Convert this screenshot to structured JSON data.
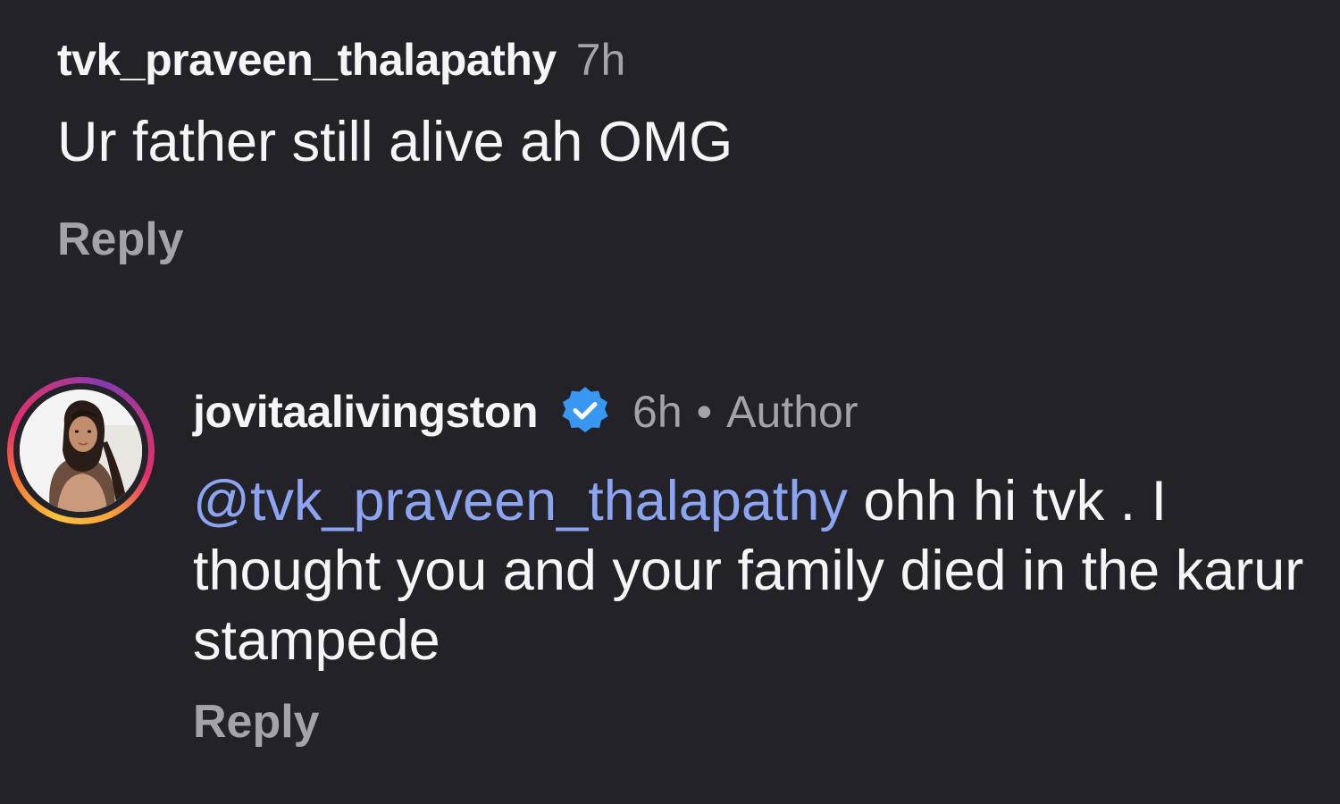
{
  "comments": [
    {
      "username": "tvk_praveen_thalapathy",
      "time": "7h",
      "text": "Ur father still alive ah OMG",
      "reply_label": "Reply"
    },
    {
      "username": "jovitaalivingston",
      "verified": true,
      "time": "6h",
      "separator": "•",
      "badge": "Author",
      "mention": "@tvk_praveen_thalapathy",
      "text": " ohh hi tvk . I thought you and your family died in the karur stampede",
      "reply_label": "Reply"
    }
  ],
  "colors": {
    "background": "#232228",
    "primary_text": "#f5f5f7",
    "secondary_text": "#a4a3a9",
    "mention": "#8da5f0",
    "verified_badge": "#3897f0"
  }
}
